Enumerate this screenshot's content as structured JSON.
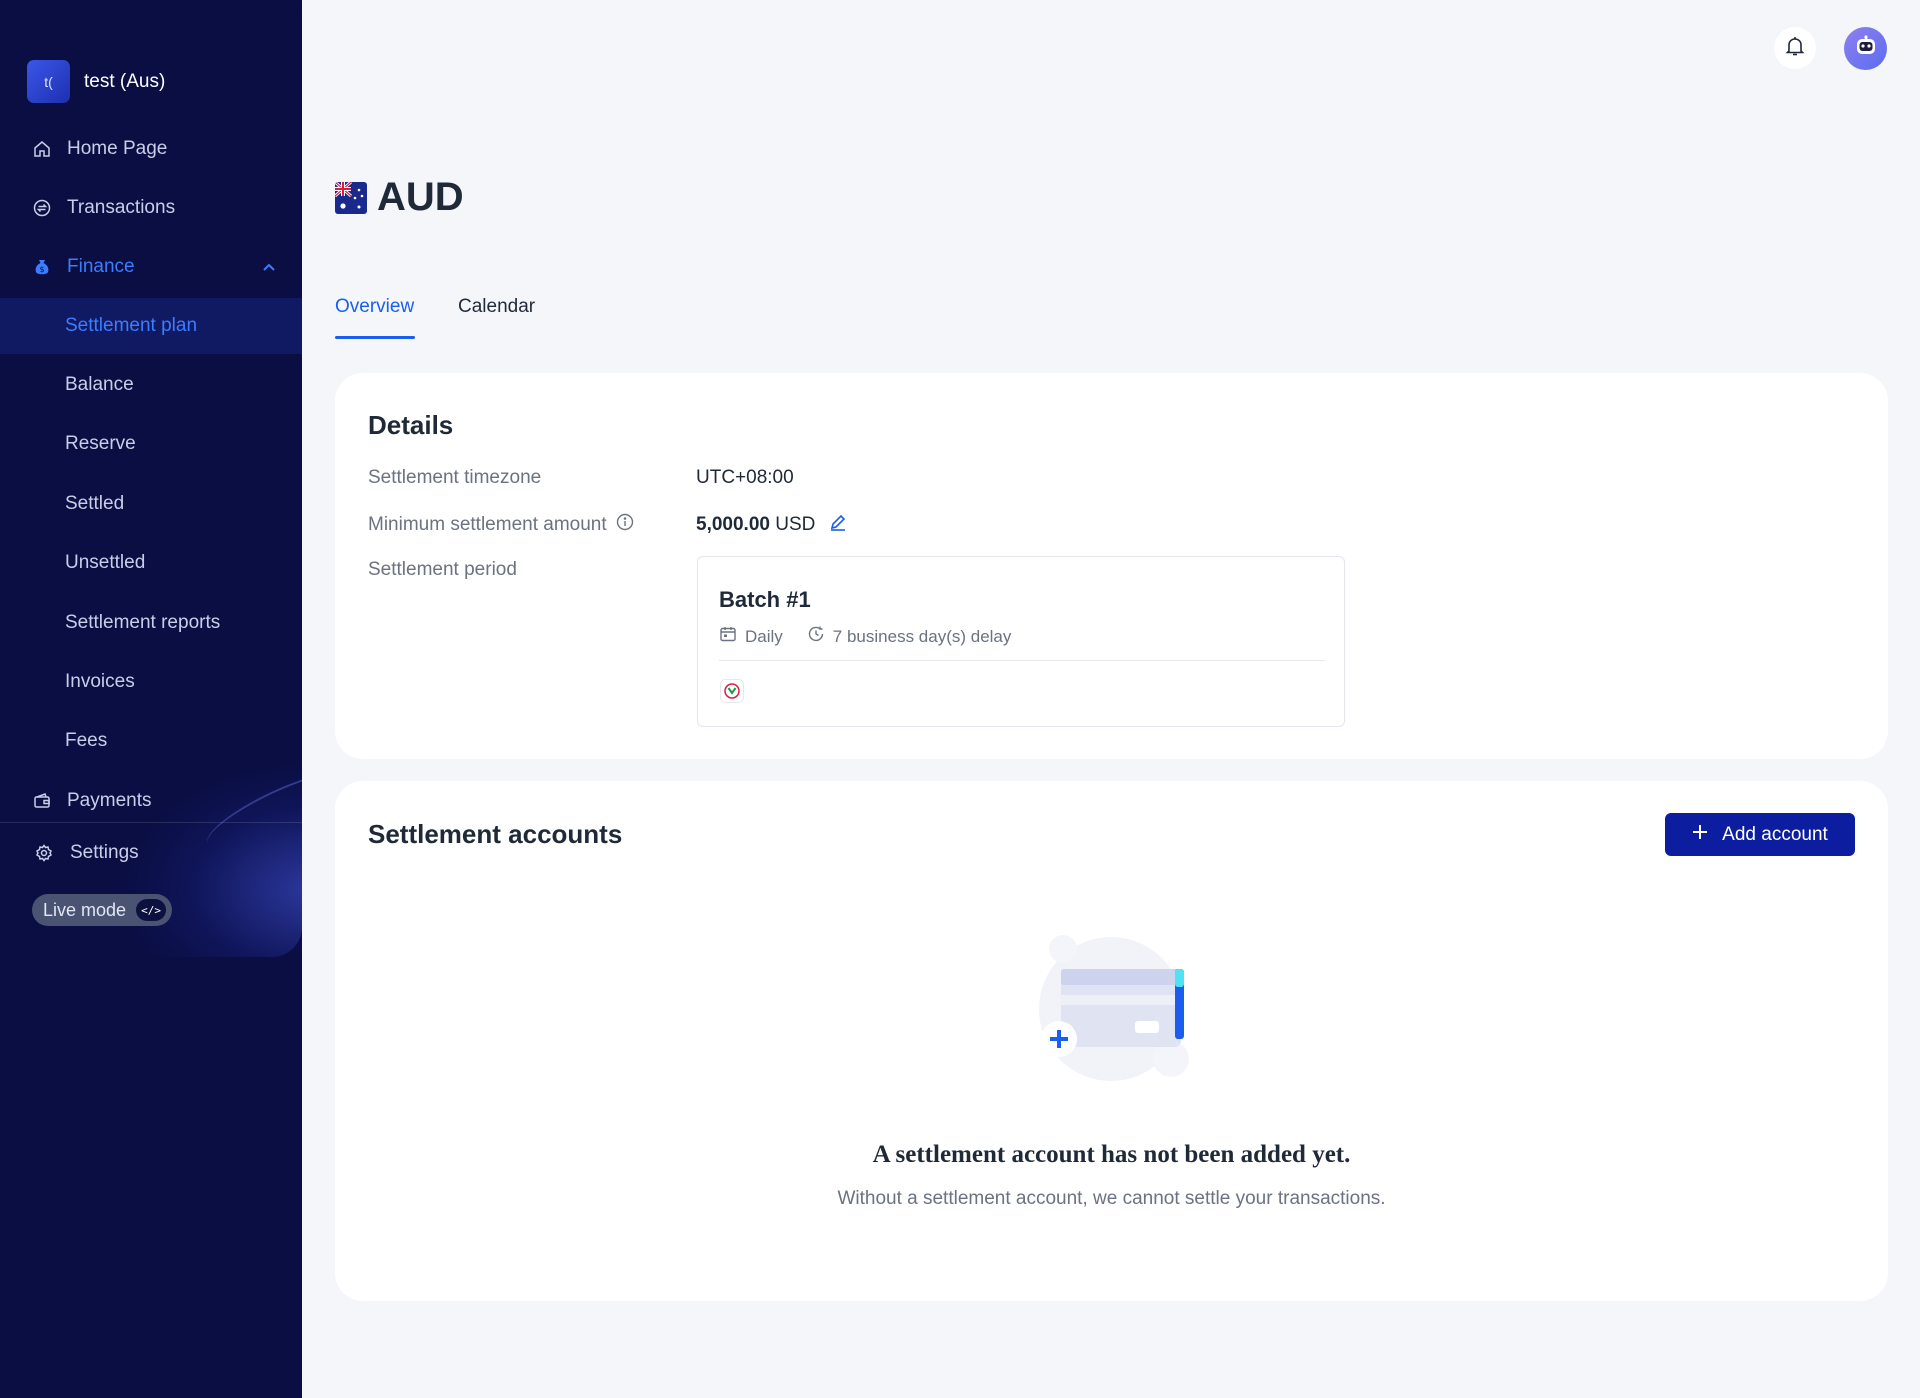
{
  "workspace": {
    "logo_text": "t(",
    "name": "test (Aus)"
  },
  "nav": {
    "home": "Home Page",
    "transactions": "Transactions",
    "finance": "Finance",
    "finance_sub": [
      "Settlement plan",
      "Balance",
      "Reserve",
      "Settled",
      "Unsettled",
      "Settlement reports",
      "Invoices",
      "Fees"
    ],
    "payments": "Payments",
    "settings": "Settings",
    "live_mode": "Live mode",
    "live_mode_badge": "</>"
  },
  "page": {
    "currency": "AUD",
    "flag": "australia-flag-icon"
  },
  "tabs": [
    "Overview",
    "Calendar"
  ],
  "details": {
    "title": "Details",
    "timezone_label": "Settlement timezone",
    "timezone_value": "UTC+08:00",
    "min_amount_label": "Minimum settlement amount",
    "min_amount_value": "5,000.00",
    "min_amount_currency": "USD",
    "period_label": "Settlement period",
    "batch": {
      "title": "Batch #1",
      "frequency": "Daily",
      "delay": "7 business day(s) delay"
    }
  },
  "accounts": {
    "title": "Settlement accounts",
    "add_button": "Add account",
    "empty_title": "A settlement account has not been added yet.",
    "empty_desc": "Without a settlement account, we cannot settle your transactions."
  },
  "colors": {
    "sidebar": "#0a0e43",
    "accent": "#1a5ef0",
    "primary_button": "#0c1e9f"
  }
}
